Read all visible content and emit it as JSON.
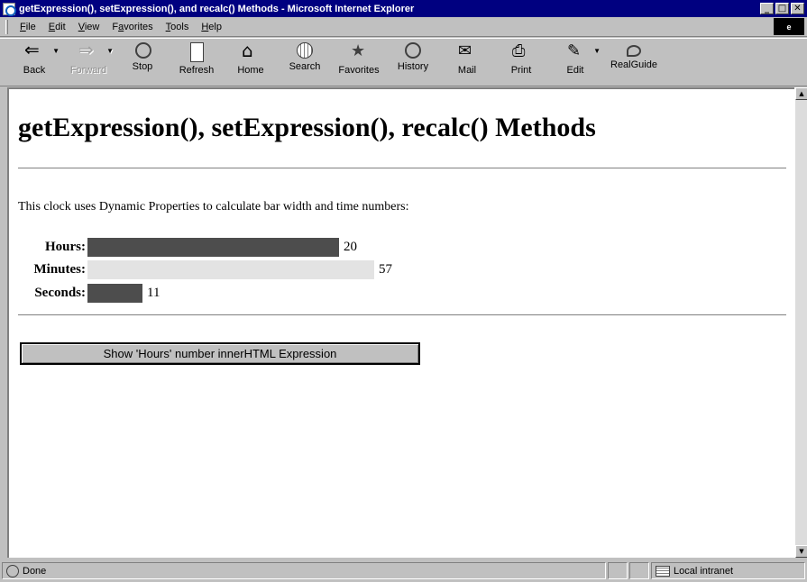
{
  "window": {
    "title": "getExpression(), setExpression(), and recalc() Methods - Microsoft Internet Explorer",
    "buttons": {
      "minimize": "_",
      "maximize": "□",
      "close": "✕"
    }
  },
  "menu": {
    "items": [
      {
        "label": "File",
        "accel": "F"
      },
      {
        "label": "Edit",
        "accel": "E"
      },
      {
        "label": "View",
        "accel": "V"
      },
      {
        "label": "Favorites",
        "accel": "a"
      },
      {
        "label": "Tools",
        "accel": "T"
      },
      {
        "label": "Help",
        "accel": "H"
      }
    ]
  },
  "toolbar": {
    "buttons": [
      {
        "label": "Back",
        "icon": "back-arrow-icon",
        "enabled": true,
        "dropdown": true
      },
      {
        "label": "Forward",
        "icon": "forward-arrow-icon",
        "enabled": false,
        "dropdown": true
      },
      {
        "label": "Stop",
        "icon": "stop-icon",
        "enabled": true,
        "dropdown": false
      },
      {
        "label": "Refresh",
        "icon": "refresh-icon",
        "enabled": true,
        "dropdown": false
      },
      {
        "label": "Home",
        "icon": "home-icon",
        "enabled": true,
        "dropdown": false
      },
      {
        "label": "Search",
        "icon": "search-icon",
        "enabled": true,
        "dropdown": false
      },
      {
        "label": "Favorites",
        "icon": "favorites-icon",
        "enabled": true,
        "dropdown": false
      },
      {
        "label": "History",
        "icon": "history-icon",
        "enabled": true,
        "dropdown": false
      },
      {
        "label": "Mail",
        "icon": "mail-icon",
        "enabled": true,
        "dropdown": true
      },
      {
        "label": "Print",
        "icon": "print-icon",
        "enabled": true,
        "dropdown": false
      },
      {
        "label": "Edit",
        "icon": "edit-icon",
        "enabled": true,
        "dropdown": true
      },
      {
        "label": "RealGuide",
        "icon": "realguide-icon",
        "enabled": true,
        "dropdown": false
      }
    ]
  },
  "page": {
    "heading": "getExpression(), setExpression(), recalc() Methods",
    "intro": "This clock uses Dynamic Properties to calculate bar width and time numbers:",
    "rows": [
      {
        "label": "Hours:",
        "value": "20",
        "color": "#4d4d4d"
      },
      {
        "label": "Minutes:",
        "value": "57",
        "color": "#e3e3e3"
      },
      {
        "label": "Seconds:",
        "value": "11",
        "color": "#4d4d4d"
      }
    ],
    "button_label": "Show 'Hours' number innerHTML Expression"
  },
  "status": {
    "text": "Done",
    "zone": "Local intranet"
  }
}
